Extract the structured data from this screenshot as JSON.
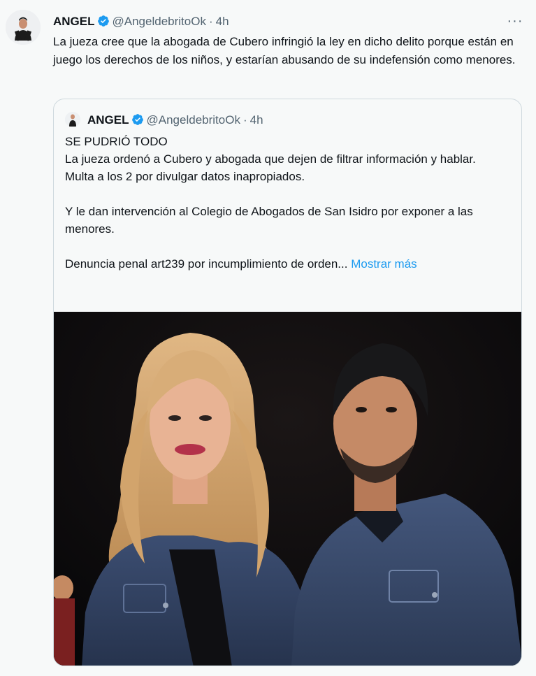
{
  "tweet": {
    "name": "ANGEL",
    "handle": "@AngeldebritoOk",
    "separator": "·",
    "time": "4h",
    "more_icon": "more-dots-icon",
    "text": "La jueza cree que la abogada de Cubero infringió la ley en dicho delito porque están en juego los derechos de los niños, y estarían abusando de su indefensión como menores."
  },
  "quoted": {
    "name": "ANGEL",
    "handle": "@AngeldebritoOk",
    "separator": "·",
    "time": "4h",
    "text": "SE PUDRIÓ TODO\nLa jueza ordenó a Cubero y abogada que dejen de filtrar información y hablar.\nMulta a los 2 por divulgar datos inapropiados.\n\nY le dan intervención al Colegio de Abogados de San Isidro por exponer a las menores.\n\nDenuncia penal art239 por incumplimiento de orden... ",
    "show_more": "Mostrar más"
  },
  "colors": {
    "accent": "#1d9bf0",
    "secondary_text": "#536471",
    "background": "#f7f9f9",
    "border": "#cfd9de"
  }
}
